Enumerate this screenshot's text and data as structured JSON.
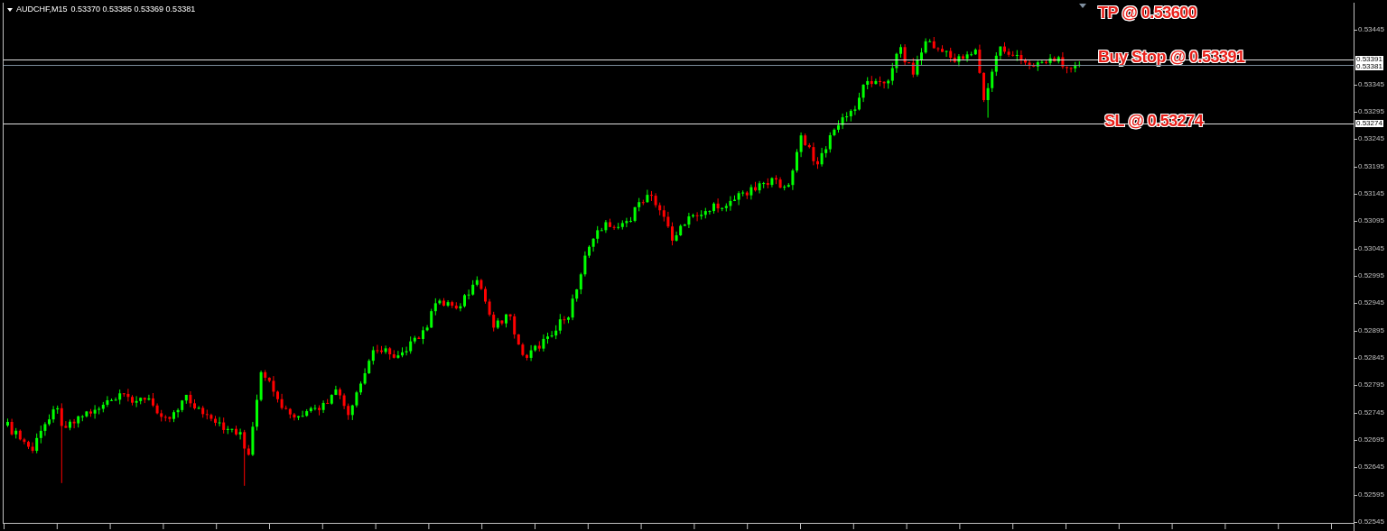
{
  "chart": {
    "symbol": "AUDCHF,M15",
    "ohlc": "0.53370 0.53385 0.53369 0.53381"
  },
  "levels": [
    {
      "kind": "tp",
      "label": "TP @ 0.53600"
    },
    {
      "kind": "buy_stop",
      "label": "Buy Stop @ 0.53391",
      "tag": "0.53391"
    },
    {
      "kind": "bid",
      "tag": "0.53381"
    },
    {
      "kind": "sl",
      "label": "SL @ 0.53274",
      "tag": "0.53274"
    }
  ],
  "price_axis": [
    "0.53445",
    "0.53345",
    "0.53295",
    "0.53245",
    "0.53195",
    "0.53145",
    "0.53095",
    "0.53045",
    "0.52995",
    "0.52945",
    "0.52895",
    "0.52845",
    "0.52795",
    "0.52745",
    "0.52695",
    "0.52645",
    "0.52595",
    "0.52545"
  ]
}
